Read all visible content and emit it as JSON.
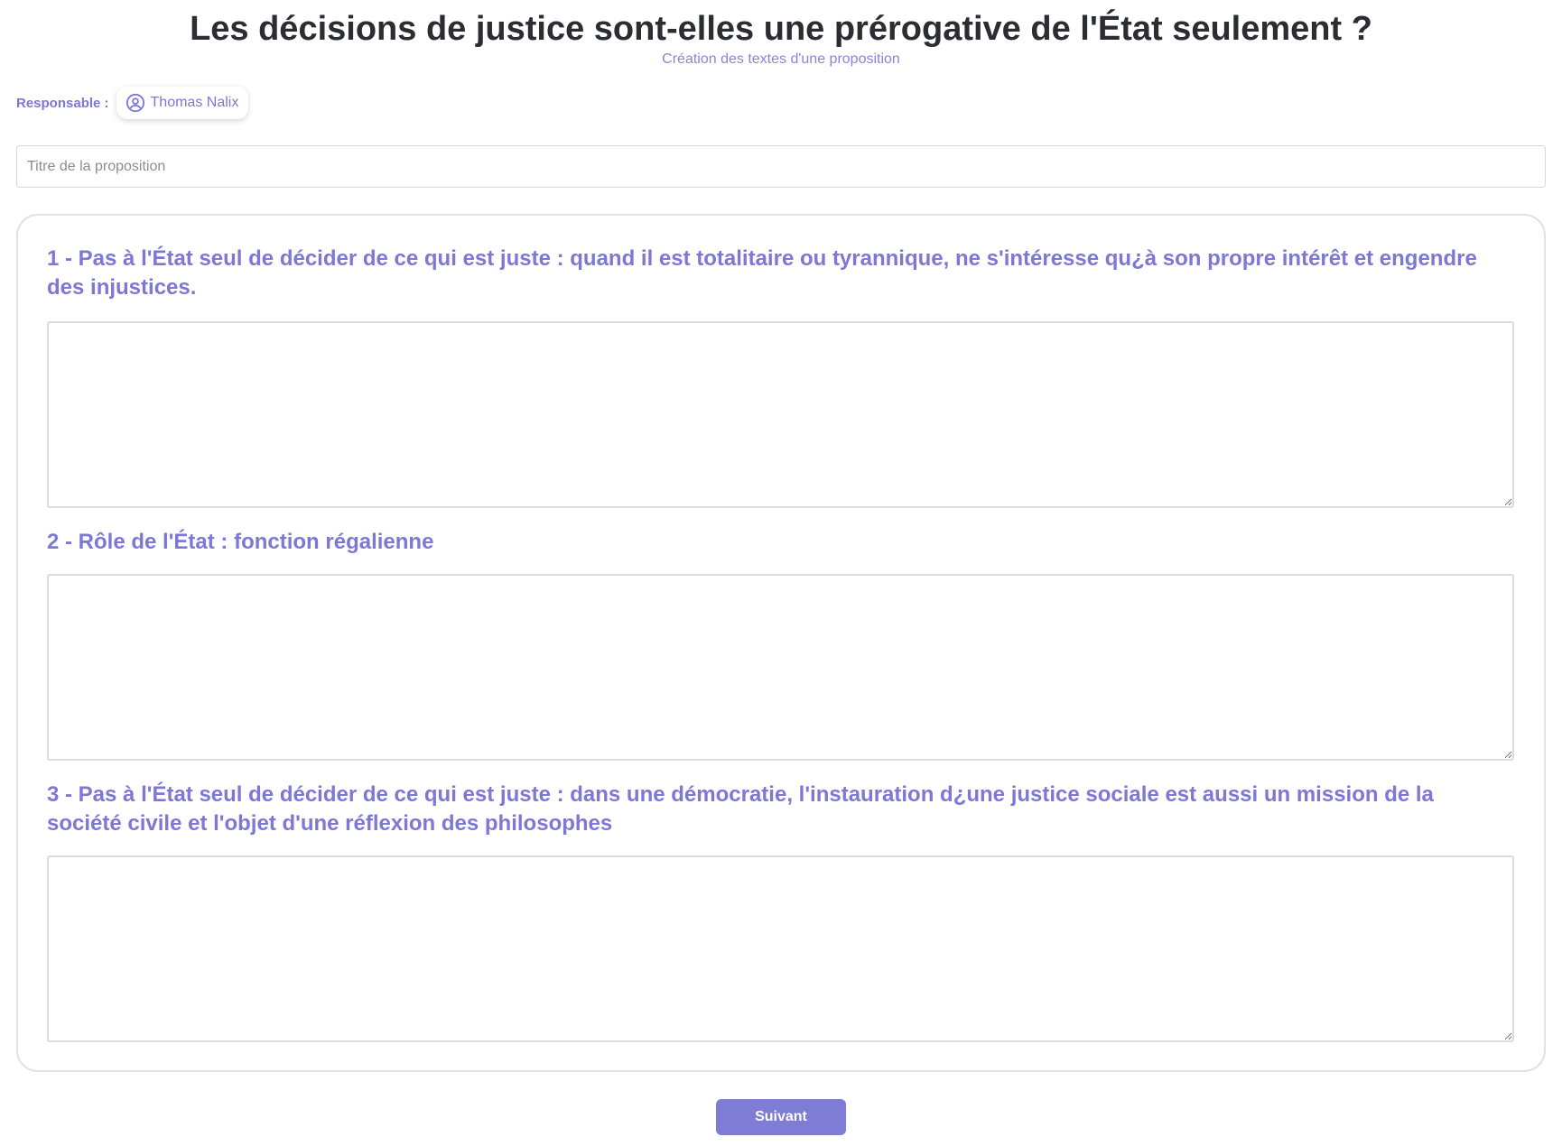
{
  "header": {
    "title": "Les décisions de justice sont-elles une prérogative de l'État seulement ?",
    "subtitle": "Création des textes d'une proposition"
  },
  "responsable": {
    "label": "Responsable :",
    "name": "Thomas Nalix",
    "icon": "user-circle-icon"
  },
  "proposal_title": {
    "placeholder": "Titre de la proposition",
    "value": ""
  },
  "sections": [
    {
      "label": "1 - Pas à l'État seul de décider de ce qui est juste : quand il est totalitaire ou tyrannique, ne s'intéresse qu¿à son propre intérêt et engendre des injustices.",
      "value": ""
    },
    {
      "label": "2 - Rôle de l'État : fonction régalienne",
      "value": ""
    },
    {
      "label": "3 - Pas à l'État seul de décider de ce qui est juste : dans une démocratie, l'instauration d¿une justice sociale est aussi un mission de la société civile et l'objet d'une réflexion des philosophes",
      "value": ""
    }
  ],
  "actions": {
    "next_label": "Suivant"
  },
  "colors": {
    "accent": "#7d77d6",
    "button": "#7f7cd6",
    "title": "#2b2d33"
  }
}
